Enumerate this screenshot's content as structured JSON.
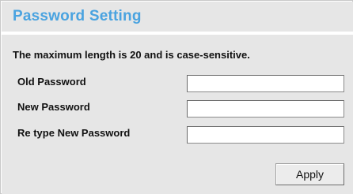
{
  "header": {
    "title": "Password Setting"
  },
  "form": {
    "description": "The maximum length is 20 and is case-sensitive.",
    "fields": [
      {
        "label": "Old Password",
        "value": "",
        "placeholder": ""
      },
      {
        "label": "New Password",
        "value": "",
        "placeholder": ""
      },
      {
        "label": "Re type New Password",
        "value": "",
        "placeholder": ""
      }
    ],
    "apply_label": "Apply"
  },
  "colors": {
    "title": "#4aa3e0",
    "panel_background": "#e6e6e6",
    "text": "#111111"
  }
}
